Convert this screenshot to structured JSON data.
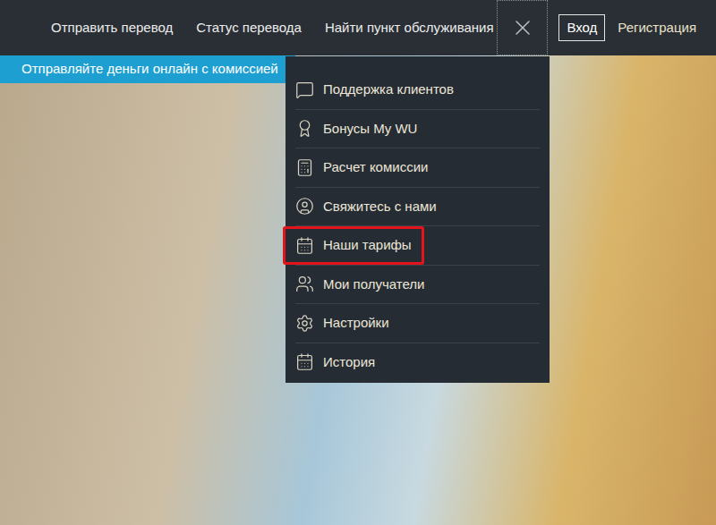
{
  "nav": {
    "links": [
      "Отправить перевод",
      "Статус перевода",
      "Найти пункт обслуживания"
    ],
    "login": "Вход",
    "register": "Регистрация"
  },
  "banner": {
    "text": "Отправляйте деньги онлайн с комиссией"
  },
  "menu": {
    "open": true,
    "items": [
      {
        "label": "Поддержка клиентов",
        "highlighted": false
      },
      {
        "label": "Бонусы My WU",
        "highlighted": false
      },
      {
        "label": "Расчет комиссии",
        "highlighted": false
      },
      {
        "label": "Свяжитесь с нами",
        "highlighted": false
      },
      {
        "label": "Наши тарифы",
        "highlighted": true
      },
      {
        "label": "Мои получатели",
        "highlighted": false
      },
      {
        "label": "Настройки",
        "highlighted": false
      },
      {
        "label": "История",
        "highlighted": false
      }
    ]
  }
}
